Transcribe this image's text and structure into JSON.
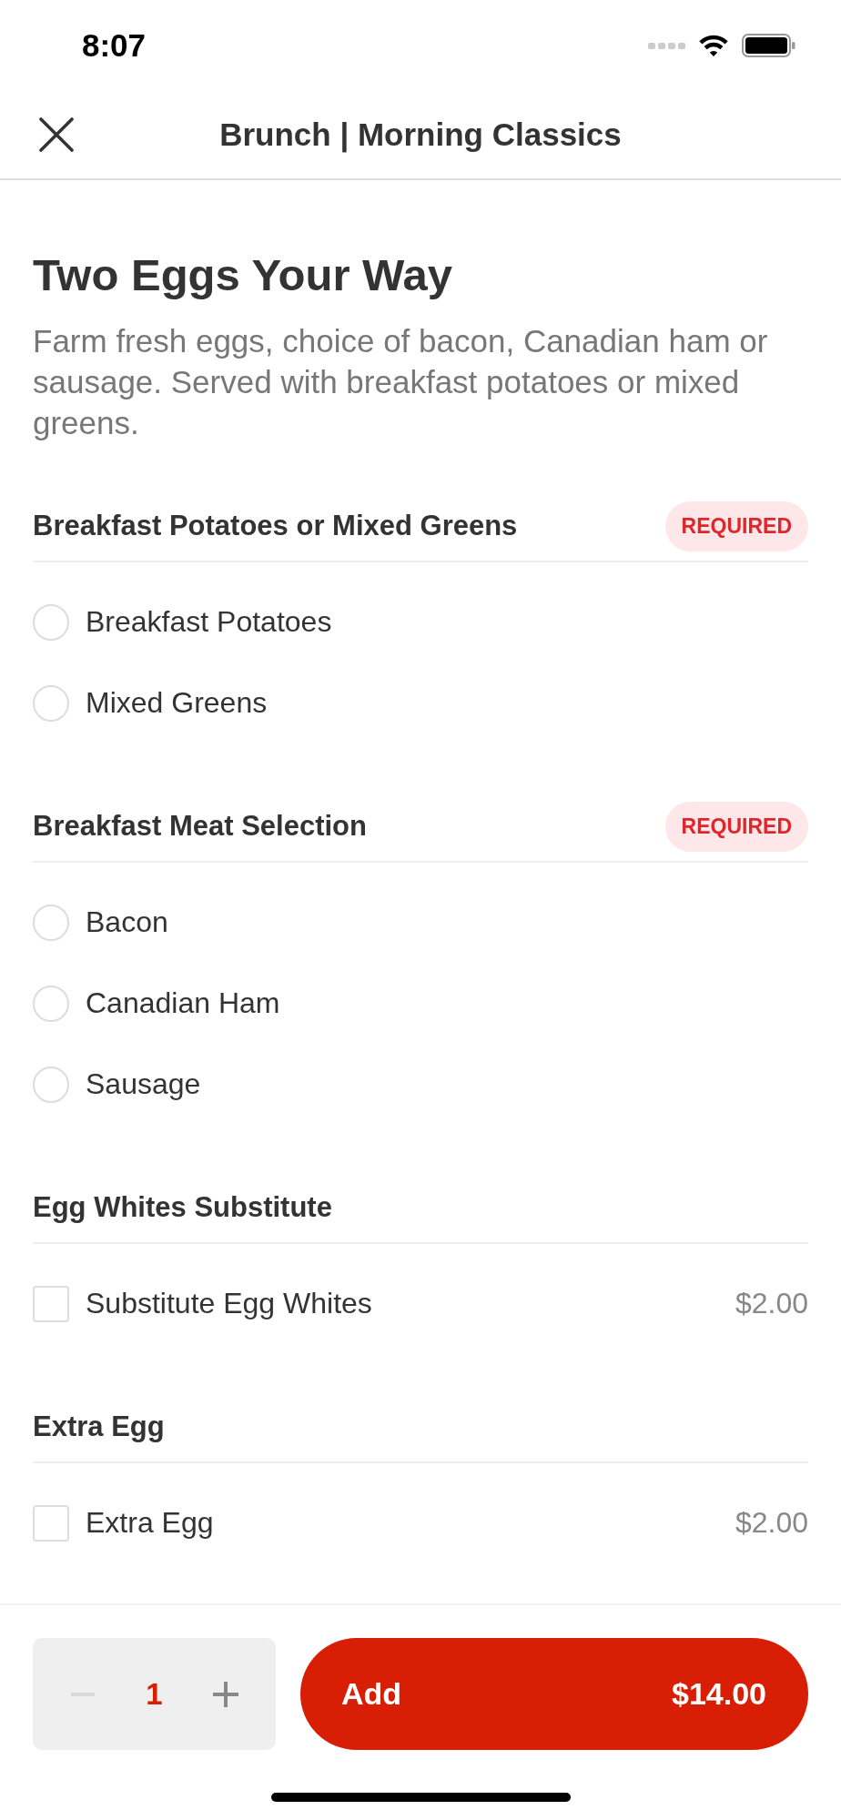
{
  "status_bar": {
    "time": "8:07"
  },
  "header": {
    "title": "Brunch | Morning Classics"
  },
  "item": {
    "name": "Two Eggs Your Way",
    "description": "Farm fresh eggs, choice of bacon, Canadian ham or sausage. Served with breakfast potatoes or mixed greens."
  },
  "sections": [
    {
      "title": "Breakfast Potatoes or Mixed Greens",
      "badge": "REQUIRED",
      "kind": "radio",
      "options": [
        {
          "label": "Breakfast Potatoes",
          "selected": false
        },
        {
          "label": "Mixed Greens",
          "selected": false
        }
      ]
    },
    {
      "title": "Breakfast Meat Selection",
      "badge": "REQUIRED",
      "kind": "radio",
      "options": [
        {
          "label": "Bacon",
          "selected": false
        },
        {
          "label": "Canadian Ham",
          "selected": false
        },
        {
          "label": "Sausage",
          "selected": false
        }
      ]
    },
    {
      "title": "Egg Whites Substitute",
      "kind": "checkbox",
      "options": [
        {
          "label": "Substitute Egg Whites",
          "price": "$2.00",
          "checked": false
        }
      ]
    },
    {
      "title": "Extra Egg",
      "kind": "checkbox",
      "options": [
        {
          "label": "Extra Egg",
          "price": "$2.00",
          "checked": false
        }
      ]
    }
  ],
  "footer": {
    "stepper": {
      "quantity": "1",
      "decrease_disabled": true,
      "increase_disabled": false
    },
    "add_button": {
      "label": "Add",
      "price": "$14.00"
    }
  }
}
